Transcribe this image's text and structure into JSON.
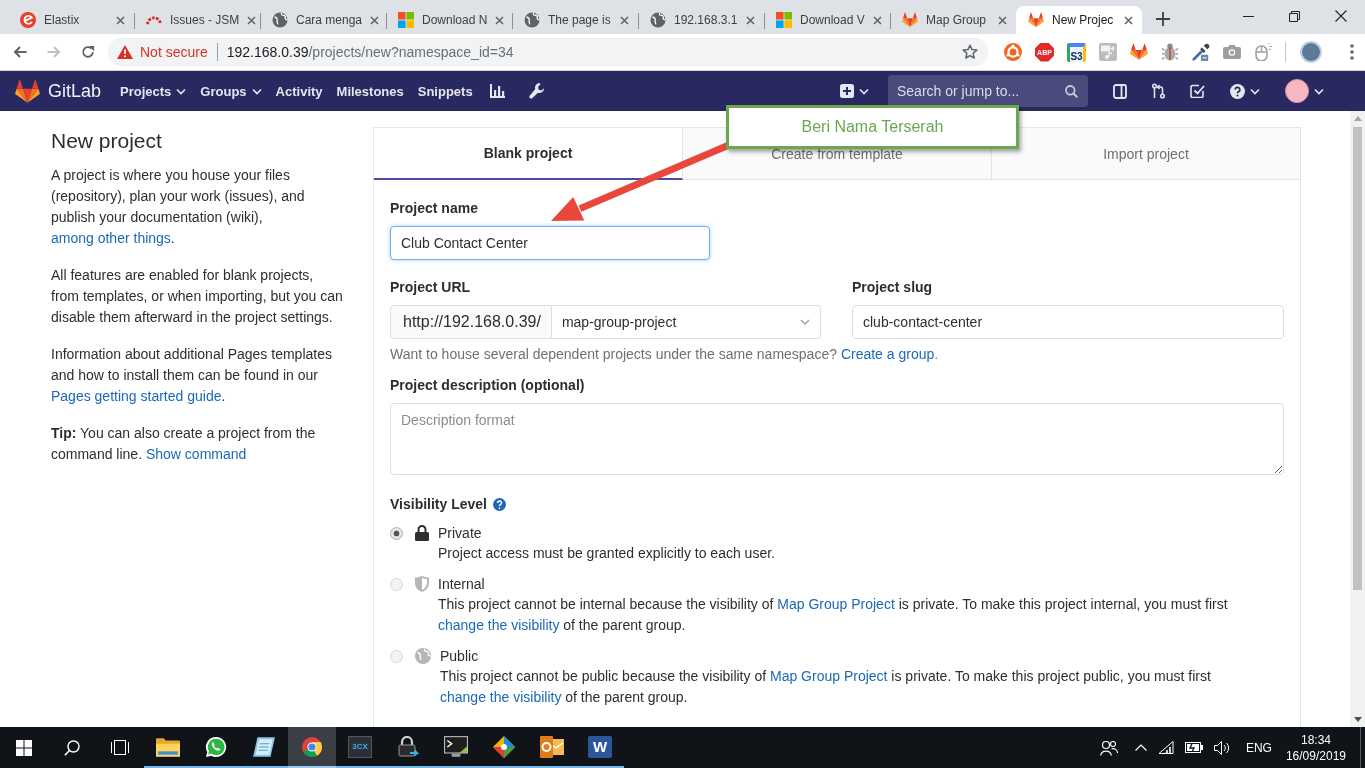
{
  "browser": {
    "tabs": [
      {
        "title": "Elastix",
        "kind": "swirl",
        "selected": false
      },
      {
        "title": "Issues - JSM",
        "kind": "arcs",
        "selected": false
      },
      {
        "title": "Cara menga",
        "kind": "globe",
        "selected": false
      },
      {
        "title": "Download N",
        "kind": "squares",
        "selected": false
      },
      {
        "title": "The page is",
        "kind": "globe",
        "selected": false
      },
      {
        "title": "192.168.3.1",
        "kind": "globe",
        "selected": false
      },
      {
        "title": "Download V",
        "kind": "squares",
        "selected": false
      },
      {
        "title": "Map Group",
        "kind": "fox",
        "selected": false
      },
      {
        "title": "New Projec",
        "kind": "fox",
        "selected": true
      }
    ],
    "address": {
      "security": "Not secure",
      "host": "192.168.0.39",
      "path": "/projects/new?namespace_id=34"
    },
    "extensions": [
      {
        "kind": "ring"
      },
      {
        "kind": "abp",
        "label": "ABP"
      },
      {
        "kind": "s3",
        "label": "S3"
      },
      {
        "kind": "media"
      },
      {
        "kind": "fox"
      },
      {
        "kind": "bug"
      },
      {
        "kind": "dropper"
      },
      {
        "kind": "camera"
      },
      {
        "kind": "mouse"
      }
    ]
  },
  "navbar": {
    "brand": "GitLab",
    "menu": [
      {
        "label": "Projects",
        "dropdown": true
      },
      {
        "label": "Groups",
        "dropdown": true
      },
      {
        "label": "Activity",
        "dropdown": false
      },
      {
        "label": "Milestones",
        "dropdown": false
      },
      {
        "label": "Snippets",
        "dropdown": false
      }
    ],
    "search": {
      "placeholder": "Search or jump to..."
    }
  },
  "sidebar": {
    "title": "New project",
    "paragraphs": [
      {
        "parts": [
          {
            "text": "A project is where you house your files (repository), plan your work (issues), and publish your documentation (wiki), "
          },
          {
            "link": "among other things"
          },
          {
            "text": "."
          }
        ]
      },
      {
        "parts": [
          {
            "text": "All features are enabled for blank projects, from templates, or when importing, but you can disable them afterward in the project settings."
          }
        ]
      },
      {
        "parts": [
          {
            "text": "Information about additional Pages templates and how to install them can be found in our "
          },
          {
            "link": "Pages getting started guide"
          },
          {
            "text": "."
          }
        ]
      },
      {
        "parts": [
          {
            "text": "**Tip:** You can also create a project from the command line. "
          },
          {
            "link": "Show command"
          }
        ]
      }
    ]
  },
  "form": {
    "tabs": [
      {
        "label": "Blank project",
        "selected": true
      },
      {
        "label": "Create from template",
        "selected": false
      },
      {
        "label": "Import project",
        "selected": false
      }
    ],
    "project_name": {
      "label": "Project name",
      "value": "Club Contact Center",
      "focused": true
    },
    "project_url": {
      "label": "Project URL",
      "prefix": "http://192.168.0.39/",
      "namespace": "map-group-project"
    },
    "project_slug": {
      "label": "Project slug",
      "value": "club-contact-center"
    },
    "namespace_help": [
      {
        "text": "Want to house several dependent projects under the same namespace? "
      },
      {
        "link": "Create a group"
      },
      {
        "text": "."
      }
    ],
    "description": {
      "label": "Project description (optional)",
      "placeholder": "Description format"
    },
    "visibility": {
      "label": "Visibility Level",
      "options": [
        {
          "kind": "private",
          "label": "Private",
          "selected": true,
          "disabled": false,
          "description": [
            {
              "text": "Project access must be granted explicitly to each user."
            }
          ]
        },
        {
          "kind": "internal",
          "label": "Internal",
          "selected": false,
          "disabled": true,
          "description": [
            {
              "text": "This project cannot be internal because the visibility of "
            },
            {
              "link": "Map Group Project"
            },
            {
              "text": " is private. To make this project internal, you must first "
            },
            {
              "link": "change the visibility"
            },
            {
              "text": " of the parent group."
            }
          ]
        },
        {
          "kind": "public",
          "label": "Public",
          "selected": false,
          "disabled": true,
          "description": [
            {
              "text": "This project cannot be public because the visibility of "
            },
            {
              "link": "Map Group Project"
            },
            {
              "text": " is private. To make this project public, you must first "
            },
            {
              "link": "change the visibility"
            },
            {
              "text": " of the parent group."
            }
          ]
        }
      ]
    }
  },
  "annotation": {
    "callout": "Beri Nama Terserah"
  },
  "taskbar": {
    "apps": [
      {
        "kind": "folder",
        "selected": false,
        "running": true
      },
      {
        "kind": "chat",
        "selected": false,
        "running": true
      },
      {
        "kind": "notepad",
        "selected": false,
        "running": true
      },
      {
        "kind": "browser",
        "selected": true,
        "running": true
      },
      {
        "kind": "dialer",
        "label": "3CX",
        "selected": false,
        "running": true
      },
      {
        "kind": "padlock",
        "selected": false,
        "running": true
      },
      {
        "kind": "monitor",
        "selected": false,
        "running": true
      },
      {
        "kind": "diamond",
        "selected": false,
        "running": true
      },
      {
        "kind": "envelope",
        "selected": false,
        "running": true
      },
      {
        "kind": "document",
        "label": "W",
        "selected": false,
        "running": true
      }
    ],
    "language": "ENG",
    "time": "18:34",
    "date": "16/09/2019"
  }
}
